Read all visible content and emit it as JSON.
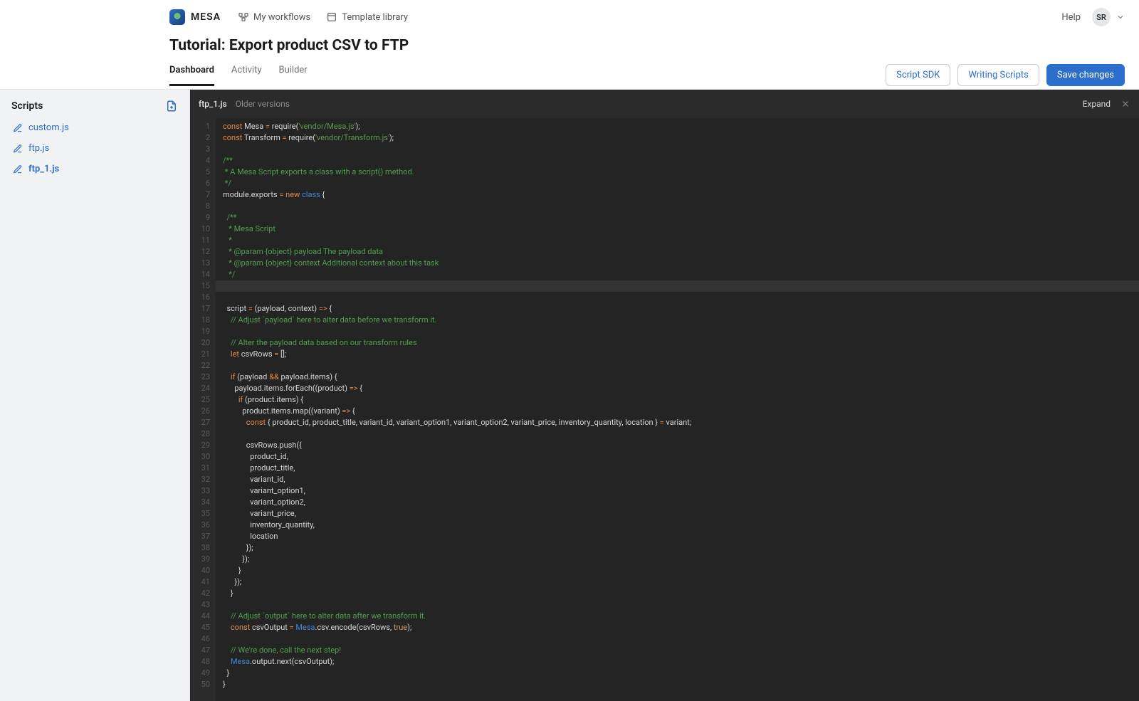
{
  "brand": {
    "name": "MESA"
  },
  "topnav": {
    "workflows": "My workflows",
    "templates": "Template library"
  },
  "help_label": "Help",
  "user_initials": "SR",
  "page_title": "Tutorial: Export product CSV to FTP",
  "tabs": {
    "dashboard": "Dashboard",
    "activity": "Activity",
    "builder": "Builder"
  },
  "actions": {
    "sdk": "Script SDK",
    "docs": "Writing Scripts",
    "save": "Save changes"
  },
  "sidebar": {
    "title": "Scripts",
    "files": [
      {
        "name": "custom.js",
        "active": false
      },
      {
        "name": "ftp.js",
        "active": false
      },
      {
        "name": "ftp_1.js",
        "active": true
      }
    ]
  },
  "editor": {
    "filename": "ftp_1.js",
    "older": "Older versions",
    "expand": "Expand",
    "line_count": 50,
    "current_line": 15,
    "code_lines": [
      {
        "tokens": [
          [
            "k",
            "const"
          ],
          [
            "p",
            " Mesa "
          ],
          [
            "k",
            "="
          ],
          [
            "p",
            " require("
          ],
          [
            "s",
            "'vendor/Mesa.js'"
          ],
          [
            "p",
            ");"
          ]
        ]
      },
      {
        "tokens": [
          [
            "k",
            "const"
          ],
          [
            "p",
            " Transform "
          ],
          [
            "k",
            "="
          ],
          [
            "p",
            " require("
          ],
          [
            "s",
            "'vendor/Transform.js'"
          ],
          [
            "p",
            ");"
          ]
        ]
      },
      {
        "tokens": []
      },
      {
        "tokens": [
          [
            "c",
            "/**"
          ]
        ]
      },
      {
        "tokens": [
          [
            "c",
            " * A Mesa Script exports a class with a script() method."
          ]
        ]
      },
      {
        "tokens": [
          [
            "c",
            " */"
          ]
        ]
      },
      {
        "tokens": [
          [
            "p",
            "module.exports "
          ],
          [
            "k",
            "="
          ],
          [
            "p",
            " "
          ],
          [
            "k",
            "new"
          ],
          [
            "p",
            " "
          ],
          [
            "t",
            "class"
          ],
          [
            "p",
            " {"
          ]
        ]
      },
      {
        "tokens": []
      },
      {
        "tokens": [
          [
            "c",
            "  /**"
          ]
        ]
      },
      {
        "tokens": [
          [
            "c",
            "   * Mesa Script"
          ]
        ]
      },
      {
        "tokens": [
          [
            "c",
            "   *"
          ]
        ]
      },
      {
        "tokens": [
          [
            "c",
            "   * @param {object} payload The payload data"
          ]
        ]
      },
      {
        "tokens": [
          [
            "c",
            "   * @param {object} context Additional context about this task"
          ]
        ]
      },
      {
        "tokens": [
          [
            "c",
            "   */"
          ]
        ]
      },
      {
        "tokens": []
      },
      {
        "tokens": [
          [
            "p",
            "  script "
          ],
          [
            "k",
            "="
          ],
          [
            "p",
            " (payload, context) "
          ],
          [
            "k",
            "=>"
          ],
          [
            "p",
            " {"
          ]
        ]
      },
      {
        "tokens": [
          [
            "c",
            "    // Adjust `payload` here to alter data before we transform it."
          ]
        ]
      },
      {
        "tokens": []
      },
      {
        "tokens": [
          [
            "c",
            "    // Alter the payload data based on our transform rules"
          ]
        ]
      },
      {
        "tokens": [
          [
            "p",
            "    "
          ],
          [
            "k",
            "let"
          ],
          [
            "p",
            " csvRows "
          ],
          [
            "k",
            "="
          ],
          [
            "p",
            " [];"
          ]
        ]
      },
      {
        "tokens": []
      },
      {
        "tokens": [
          [
            "p",
            "    "
          ],
          [
            "k",
            "if"
          ],
          [
            "p",
            " (payload "
          ],
          [
            "k",
            "&&"
          ],
          [
            "p",
            " payload.items) {"
          ]
        ]
      },
      {
        "tokens": [
          [
            "p",
            "      payload.items.forEach((product) "
          ],
          [
            "k",
            "=>"
          ],
          [
            "p",
            " {"
          ]
        ]
      },
      {
        "tokens": [
          [
            "p",
            "        "
          ],
          [
            "k",
            "if"
          ],
          [
            "p",
            " (product.items) {"
          ]
        ]
      },
      {
        "tokens": [
          [
            "p",
            "          product.items.map((variant) "
          ],
          [
            "k",
            "=>"
          ],
          [
            "p",
            " {"
          ]
        ]
      },
      {
        "tokens": [
          [
            "p",
            "            "
          ],
          [
            "k",
            "const"
          ],
          [
            "p",
            " { product_id, product_title, variant_id, variant_option1, variant_option2, variant_price, inventory_quantity, location } "
          ],
          [
            "k",
            "="
          ],
          [
            "p",
            " variant;"
          ]
        ]
      },
      {
        "tokens": []
      },
      {
        "tokens": [
          [
            "p",
            "            csvRows.push({"
          ]
        ]
      },
      {
        "tokens": [
          [
            "p",
            "              product_id,"
          ]
        ]
      },
      {
        "tokens": [
          [
            "p",
            "              product_title,"
          ]
        ]
      },
      {
        "tokens": [
          [
            "p",
            "              variant_id,"
          ]
        ]
      },
      {
        "tokens": [
          [
            "p",
            "              variant_option1,"
          ]
        ]
      },
      {
        "tokens": [
          [
            "p",
            "              variant_option2,"
          ]
        ]
      },
      {
        "tokens": [
          [
            "p",
            "              variant_price,"
          ]
        ]
      },
      {
        "tokens": [
          [
            "p",
            "              inventory_quantity,"
          ]
        ]
      },
      {
        "tokens": [
          [
            "p",
            "              location"
          ]
        ]
      },
      {
        "tokens": [
          [
            "p",
            "            });"
          ]
        ]
      },
      {
        "tokens": [
          [
            "p",
            "          });"
          ]
        ]
      },
      {
        "tokens": [
          [
            "p",
            "        }"
          ]
        ]
      },
      {
        "tokens": [
          [
            "p",
            "      });"
          ]
        ]
      },
      {
        "tokens": [
          [
            "p",
            "    }"
          ]
        ]
      },
      {
        "tokens": []
      },
      {
        "tokens": [
          [
            "c",
            "    // Adjust `output` here to alter data after we transform it."
          ]
        ]
      },
      {
        "tokens": [
          [
            "p",
            "    "
          ],
          [
            "k",
            "const"
          ],
          [
            "p",
            " csvOutput "
          ],
          [
            "k",
            "="
          ],
          [
            "p",
            " "
          ],
          [
            "t",
            "Mesa"
          ],
          [
            "p",
            ".csv.encode(csvRows, "
          ],
          [
            "b",
            "true"
          ],
          [
            "p",
            ");"
          ]
        ]
      },
      {
        "tokens": []
      },
      {
        "tokens": [
          [
            "c",
            "    // We're done, call the next step!"
          ]
        ]
      },
      {
        "tokens": [
          [
            "p",
            "    "
          ],
          [
            "t",
            "Mesa"
          ],
          [
            "p",
            ".output.next(csvOutput);"
          ]
        ]
      },
      {
        "tokens": [
          [
            "p",
            "  }"
          ]
        ]
      },
      {
        "tokens": [
          [
            "p",
            "}"
          ]
        ]
      },
      {
        "tokens": []
      }
    ]
  }
}
